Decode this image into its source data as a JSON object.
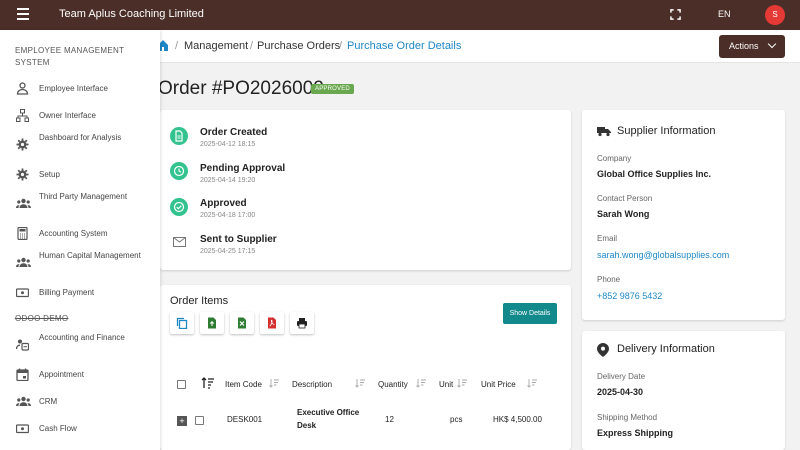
{
  "app": {
    "title": "Team Aplus Coaching Limited",
    "language": "EN",
    "avatar_initial": "S"
  },
  "breadcrumb": {
    "items": [
      "Management",
      "Purchase Orders",
      "Purchase Order Details"
    ]
  },
  "actions_label": "Actions",
  "order": {
    "title": "Order #PO2026002",
    "status": "APPROVED"
  },
  "timeline": [
    {
      "title": "Order Created",
      "time": "2025-04-12 18:15"
    },
    {
      "title": "Pending Approval",
      "time": "2025-04-14 19:20"
    },
    {
      "title": "Approved",
      "time": "2025-04-18 17:00"
    },
    {
      "title": "Sent to Supplier",
      "time": "2025-04-25 17:15"
    }
  ],
  "order_items": {
    "title": "Order Items",
    "show_details_label": "Show Details",
    "columns": [
      "Item Code",
      "Description",
      "Quantity",
      "Unit",
      "Unit Price"
    ],
    "rows": [
      {
        "item_code": "DESK001",
        "description_line1": "Executive Office",
        "description_line2": "Desk",
        "quantity": "12",
        "unit": "pcs",
        "unit_price": "HK$ 4,500.00"
      }
    ]
  },
  "supplier": {
    "heading": "Supplier Information",
    "company_label": "Company",
    "company": "Global Office Supplies Inc.",
    "contact_label": "Contact Person",
    "contact": "Sarah Wong",
    "email_label": "Email",
    "email": "sarah.wong@globalsupplies.com",
    "phone_label": "Phone",
    "phone": "+852 9876 5432"
  },
  "delivery": {
    "heading": "Delivery Information",
    "date_label": "Delivery Date",
    "date": "2025-04-30",
    "method_label": "Shipping Method",
    "method": "Express Shipping"
  },
  "sidebar": {
    "section1": "EMPLOYEE MANAGEMENT SYSTEM",
    "items1": [
      {
        "label": "Employee Interface",
        "icon": "person-icon"
      },
      {
        "label": "Owner Interface",
        "icon": "org-icon"
      },
      {
        "label": "Dashboard for Analysis",
        "icon": "gear-icon"
      },
      {
        "label": "Setup",
        "icon": "gear-icon"
      },
      {
        "label": "Third Party Management",
        "icon": "group-icon"
      },
      {
        "label": "Accounting System",
        "icon": "calculator-icon"
      },
      {
        "label": "Human Capital Management",
        "icon": "group-icon"
      },
      {
        "label": "Billing Payment",
        "icon": "payment-icon"
      }
    ],
    "section2": "ODOO DEMO",
    "items2": [
      {
        "label": "Accounting and Finance",
        "icon": "finance-icon"
      },
      {
        "label": "Appointment",
        "icon": "calendar-icon"
      },
      {
        "label": "CRM",
        "icon": "group-icon"
      },
      {
        "label": "Cash Flow",
        "icon": "payment-icon"
      }
    ]
  },
  "colors": {
    "topbar": "#4a2e27",
    "accent": "#1e88c7",
    "success": "#34c38f",
    "teal_button": "#128a8c",
    "badge": "#6aa84f"
  }
}
